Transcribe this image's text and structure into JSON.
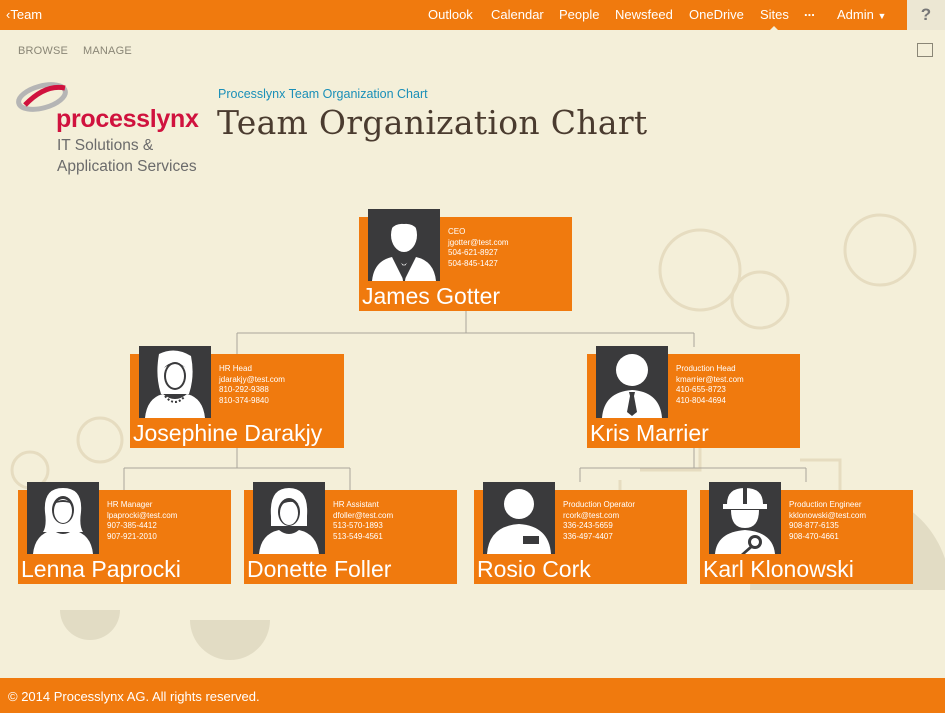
{
  "topbar": {
    "back_label": "Team",
    "nav": [
      "Outlook",
      "Calendar",
      "People",
      "Newsfeed",
      "OneDrive",
      "Sites",
      "...",
      "Admin"
    ],
    "active": "Sites",
    "help": "?"
  },
  "ribbon": {
    "browse": "BROWSE",
    "manage": "MANAGE"
  },
  "logo": {
    "name": "processlynx",
    "line1": "IT Solutions &",
    "line2": "Application Services"
  },
  "page": {
    "breadcrumb": "Processlynx Team Organization Chart",
    "title": "Team Organization Chart"
  },
  "people": [
    {
      "name": "James Gotter",
      "role": "CEO",
      "email": "jgotter@test.com",
      "phone1": "504-621-8927",
      "phone2": "504-845-1427",
      "avatar": "male-suit-icon"
    },
    {
      "name": "Josephine Darakjy",
      "role": "HR Head",
      "email": "jdarakjy@test.com",
      "phone1": "810-292-9388",
      "phone2": "810-374-9840",
      "avatar": "female-necklace-icon"
    },
    {
      "name": "Kris Marrier",
      "role": "Production Head",
      "email": "kmarrier@test.com",
      "phone1": "410-655-8723",
      "phone2": "410-804-4694",
      "avatar": "male-tie-icon"
    },
    {
      "name": "Lenna Paprocki",
      "role": "HR Manager",
      "email": "lpaprocki@test.com",
      "phone1": "907-385-4412",
      "phone2": "907-921-2010",
      "avatar": "female-icon"
    },
    {
      "name": "Donette Foller",
      "role": "HR Assistant",
      "email": "dfoller@test.com",
      "phone1": "513-570-1893",
      "phone2": "513-549-4561",
      "avatar": "female-bob-icon"
    },
    {
      "name": "Rosio Cork",
      "role": "Production Operator",
      "email": "rcork@test.com",
      "phone1": "336-243-5659",
      "phone2": "336-497-4407",
      "avatar": "operator-icon"
    },
    {
      "name": "Karl Klonowski",
      "role": "Production Engineer",
      "email": "kklonowski@test.com",
      "phone1": "908-877-6135",
      "phone2": "908-470-4661",
      "avatar": "engineer-helmet-icon"
    }
  ],
  "footer": {
    "copyright": "© 2014 Processlynx AG. All rights reserved."
  },
  "colors": {
    "accent": "#f07a0e",
    "background": "#f4efd9",
    "photo": "#3a3a3c",
    "brand_red": "#d0123e",
    "link_blue": "#1a8fb8"
  }
}
